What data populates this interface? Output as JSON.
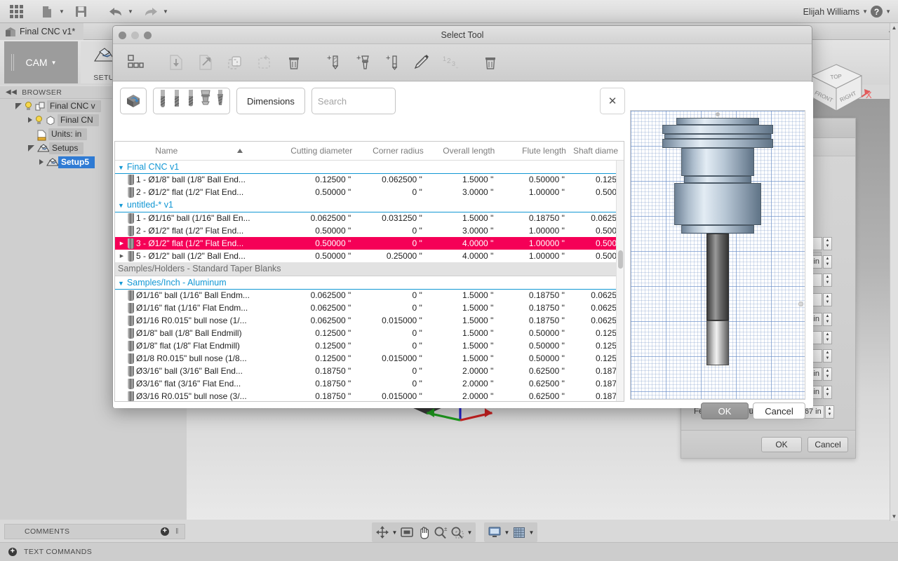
{
  "app": {
    "user": "Elijah Williams",
    "document_tab": "Final CNC v1*",
    "workspace": "CAM",
    "ribbon_group": "SETU",
    "browser_label": "BROWSER",
    "comments_label": "COMMENTS",
    "text_commands_label": "TEXT COMMANDS",
    "toolbar_icons": [
      "grid-apps-icon",
      "new-file-icon",
      "save-icon",
      "undo-icon",
      "redo-icon"
    ],
    "navcube": {
      "top": "TOP",
      "front": "FRONT",
      "right": "RIGHT",
      "x_axis": "X",
      "z_axis": "Z"
    }
  },
  "browser": {
    "items": [
      {
        "label": "Final CNC v",
        "indent": 0,
        "expanded": true,
        "bulb": true
      },
      {
        "label": "Final CN",
        "indent": 1,
        "expanded": false,
        "bulb": true
      },
      {
        "label": "Units: in",
        "indent": 1,
        "expanded": null,
        "bulb": false
      },
      {
        "label": "Setups",
        "indent": 1,
        "expanded": true,
        "bulb": false
      },
      {
        "label": "Setup5",
        "indent": 2,
        "expanded": false,
        "bulb": false,
        "selected": true
      }
    ]
  },
  "properties_panel": {
    "dropdown_value": "",
    "fields": [
      {
        "value": ""
      },
      {
        "value": "/min"
      },
      {
        "value": ""
      },
      {
        "value": ""
      },
      {
        "value": "7 in"
      },
      {
        "value": ""
      },
      {
        "value": ""
      },
      {
        "value": "/min"
      },
      {
        "value": "/min"
      }
    ],
    "feed_per_revolution_label": "Feed per Revolution",
    "feed_per_revolution_value": "0.00266667 in",
    "ok_label": "OK",
    "cancel_label": "Cancel"
  },
  "dialog": {
    "title": "Select Tool",
    "toolbar_icons": [
      "library-grid-icon",
      "import-tool-icon",
      "export-tool-icon",
      "duplicate-tool-icon",
      "new-library-icon",
      "delete-library-icon",
      "new-cutter-icon",
      "new-holder-icon",
      "new-probe-icon",
      "edit-tool-icon",
      "renumber-icon",
      "delete-tool-icon"
    ],
    "filter": {
      "library_button": "tool-library-icon",
      "tool_type_icons": [
        "ball-endmill-icon",
        "flat-endmill-icon",
        "bull-nose-icon",
        "holder-icon",
        "taper-icon"
      ],
      "dimensions_label": "Dimensions",
      "search_value": "",
      "search_placeholder": "Search",
      "close_label": "✕"
    },
    "columns": [
      {
        "key": "name",
        "label": "Name",
        "sorted": true
      },
      {
        "key": "cutting_diameter",
        "label": "Cutting diameter"
      },
      {
        "key": "corner_radius",
        "label": "Corner radius"
      },
      {
        "key": "overall_length",
        "label": "Overall length"
      },
      {
        "key": "flute_length",
        "label": "Flute length"
      },
      {
        "key": "shaft_diameter",
        "label": "Shaft diame"
      }
    ],
    "rows": [
      {
        "type": "group",
        "label": "Final CNC v1",
        "expanded": true
      },
      {
        "type": "tool",
        "disclosure": false,
        "name": "1 - Ø1/8\" ball (1/8\" Ball End...",
        "cutting_diameter": "0.12500 \"",
        "corner_radius": "0.062500 \"",
        "overall_length": "1.5000 \"",
        "flute_length": "0.50000 \"",
        "shaft_diameter": "0.125"
      },
      {
        "type": "tool",
        "disclosure": false,
        "name": "2 - Ø1/2\" flat (1/2\" Flat End...",
        "cutting_diameter": "0.50000 \"",
        "corner_radius": "0 \"",
        "overall_length": "3.0000 \"",
        "flute_length": "1.00000 \"",
        "shaft_diameter": "0.500"
      },
      {
        "type": "group",
        "label": "untitled-* v1",
        "expanded": true
      },
      {
        "type": "tool",
        "disclosure": false,
        "name": "1 - Ø1/16\" ball (1/16\" Ball En...",
        "cutting_diameter": "0.062500 \"",
        "corner_radius": "0.031250 \"",
        "overall_length": "1.5000 \"",
        "flute_length": "0.18750 \"",
        "shaft_diameter": "0.0625"
      },
      {
        "type": "tool",
        "disclosure": false,
        "name": "2 - Ø1/2\" flat (1/2\" Flat End...",
        "cutting_diameter": "0.50000 \"",
        "corner_radius": "0 \"",
        "overall_length": "3.0000 \"",
        "flute_length": "1.00000 \"",
        "shaft_diameter": "0.500"
      },
      {
        "type": "tool",
        "disclosure": true,
        "selected": true,
        "name": "3 - Ø1/2\" flat (1/2\" Flat End...",
        "cutting_diameter": "0.50000 \"",
        "corner_radius": "0 \"",
        "overall_length": "4.0000 \"",
        "flute_length": "1.00000 \"",
        "shaft_diameter": "0.500"
      },
      {
        "type": "tool",
        "disclosure": true,
        "name": "5 - Ø1/2\" ball (1/2\" Ball End...",
        "cutting_diameter": "0.50000 \"",
        "corner_radius": "0.25000 \"",
        "overall_length": "4.0000 \"",
        "flute_length": "1.00000 \"",
        "shaft_diameter": "0.500"
      },
      {
        "type": "group-plain",
        "label": "Samples/Holders - Standard Taper Blanks"
      },
      {
        "type": "group",
        "label": "Samples/Inch - Aluminum",
        "expanded": true
      },
      {
        "type": "tool",
        "disclosure": false,
        "name": "Ø1/16\" ball (1/16\" Ball Endm...",
        "cutting_diameter": "0.062500 \"",
        "corner_radius": "0 \"",
        "overall_length": "1.5000 \"",
        "flute_length": "0.18750 \"",
        "shaft_diameter": "0.0625"
      },
      {
        "type": "tool",
        "disclosure": false,
        "name": "Ø1/16\" flat (1/16\" Flat Endm...",
        "cutting_diameter": "0.062500 \"",
        "corner_radius": "0 \"",
        "overall_length": "1.5000 \"",
        "flute_length": "0.18750 \"",
        "shaft_diameter": "0.0625"
      },
      {
        "type": "tool",
        "disclosure": false,
        "name": "Ø1/16 R0.015\" bull nose (1/...",
        "cutting_diameter": "0.062500 \"",
        "corner_radius": "0.015000 \"",
        "overall_length": "1.5000 \"",
        "flute_length": "0.18750 \"",
        "shaft_diameter": "0.0625"
      },
      {
        "type": "tool",
        "disclosure": false,
        "name": "Ø1/8\" ball (1/8\" Ball Endmill)",
        "cutting_diameter": "0.12500 \"",
        "corner_radius": "0 \"",
        "overall_length": "1.5000 \"",
        "flute_length": "0.50000 \"",
        "shaft_diameter": "0.125"
      },
      {
        "type": "tool",
        "disclosure": false,
        "name": "Ø1/8\" flat (1/8\" Flat Endmill)",
        "cutting_diameter": "0.12500 \"",
        "corner_radius": "0 \"",
        "overall_length": "1.5000 \"",
        "flute_length": "0.50000 \"",
        "shaft_diameter": "0.125"
      },
      {
        "type": "tool",
        "disclosure": false,
        "name": "Ø1/8 R0.015\" bull nose (1/8...",
        "cutting_diameter": "0.12500 \"",
        "corner_radius": "0.015000 \"",
        "overall_length": "1.5000 \"",
        "flute_length": "0.50000 \"",
        "shaft_diameter": "0.125"
      },
      {
        "type": "tool",
        "disclosure": false,
        "name": "Ø3/16\" ball (3/16\" Ball End...",
        "cutting_diameter": "0.18750 \"",
        "corner_radius": "0 \"",
        "overall_length": "2.0000 \"",
        "flute_length": "0.62500 \"",
        "shaft_diameter": "0.187"
      },
      {
        "type": "tool",
        "disclosure": false,
        "name": "Ø3/16\" flat (3/16\" Flat End...",
        "cutting_diameter": "0.18750 \"",
        "corner_radius": "0 \"",
        "overall_length": "2.0000 \"",
        "flute_length": "0.62500 \"",
        "shaft_diameter": "0.187"
      },
      {
        "type": "tool",
        "disclosure": false,
        "name": "Ø3/16 R0.015\" bull nose (3/...",
        "cutting_diameter": "0.18750 \"",
        "corner_radius": "0.015000 \"",
        "overall_length": "2.0000 \"",
        "flute_length": "0.62500 \"",
        "shaft_diameter": "0.187"
      }
    ],
    "ok_label": "OK",
    "cancel_label": "Cancel"
  },
  "view_toolbar": {
    "buttons": [
      "orbit-icon",
      "pan-view-icon",
      "pan-hand-icon",
      "zoom-icon",
      "zoom-window-icon",
      "display-settings-icon",
      "grid-snap-icon"
    ]
  },
  "colors": {
    "selection_pink": "#f50057",
    "group_blue": "#1197d4",
    "tree_selection_blue": "#2f7bd4",
    "axis_x": "#cc2222",
    "axis_y": "#1f9e1f",
    "axis_z": "#2222cc"
  }
}
